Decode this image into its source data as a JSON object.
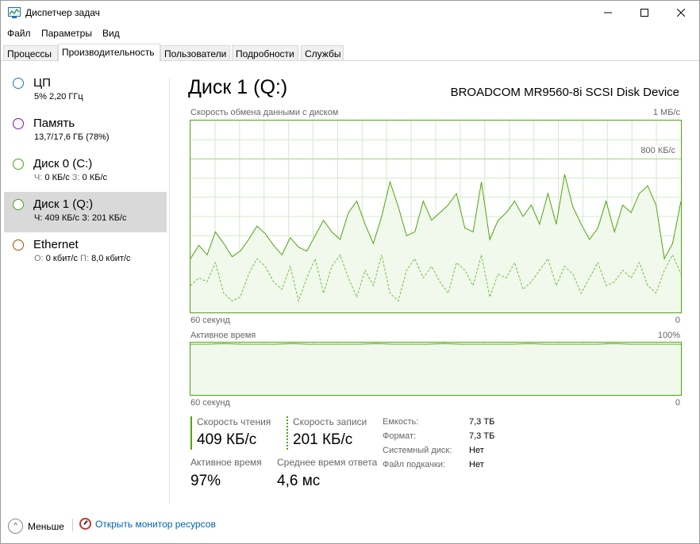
{
  "window": {
    "title": "Диспетчер задач"
  },
  "menu": [
    "Файл",
    "Параметры",
    "Вид"
  ],
  "tabs": [
    {
      "label": "Процессы",
      "active": false
    },
    {
      "label": "Производительность",
      "active": true
    },
    {
      "label": "Пользователи",
      "active": false
    },
    {
      "label": "Подробности",
      "active": false
    },
    {
      "label": "Службы",
      "active": false
    }
  ],
  "sidebar": [
    {
      "name": "ЦП",
      "sub": "5% 2,20 ГГц",
      "color": "#117dbb"
    },
    {
      "name": "Память",
      "sub": "13,7/17,6 ГБ (78%)",
      "color": "#8b12ae"
    },
    {
      "name": "Диск 0 (C:)",
      "sub_k1": "Ч:",
      "sub_v1": "0 КБ/с",
      "sub_k2": "З:",
      "sub_v2": "0 КБ/с",
      "color": "#4da60c"
    },
    {
      "name": "Диск 1 (Q:)",
      "sub_k1": "Ч:",
      "sub_v1": "409 КБ/с",
      "sub_k2": "З:",
      "sub_v2": "201 КБ/с",
      "color": "#4da60c",
      "selected": true
    },
    {
      "name": "Ethernet",
      "sub_k1": "О:",
      "sub_v1": "0 кбит/с",
      "sub_k2": "П:",
      "sub_v2": "8,0 кбит/с",
      "color": "#a74f01"
    }
  ],
  "main": {
    "title": "Диск 1 (Q:)",
    "device": "BROADCOM MR9560-8i SCSI Disk Device",
    "graph1": {
      "label": "Скорость обмена данными с диском",
      "max": "1 МБ/с",
      "marker": "800 КБ/с",
      "xleft": "60 секунд",
      "xright": "0"
    },
    "graph2": {
      "label": "Активное время",
      "max": "100%",
      "xleft": "60 секунд",
      "xright": "0"
    }
  },
  "stats": {
    "read_label": "Скорость чтения",
    "read_value": "409 КБ/с",
    "write_label": "Скорость записи",
    "write_value": "201 КБ/с",
    "active_label": "Активное время",
    "active_value": "97%",
    "resp_label": "Среднее время ответа",
    "resp_value": "4,6 мс"
  },
  "props": [
    {
      "k": "Емкость:",
      "v": "7,3 ТБ"
    },
    {
      "k": "Формат:",
      "v": "7,3 ТБ"
    },
    {
      "k": "Системный диск:",
      "v": "Нет"
    },
    {
      "k": "Файл подкачки:",
      "v": "Нет"
    }
  ],
  "footer": {
    "fewer": "Меньше",
    "resmon": "Открыть монитор ресурсов"
  },
  "chart_data": [
    {
      "type": "line",
      "title": "Скорость обмена данными с диском",
      "ylim_label": "1 МБ/с",
      "series": [
        {
          "name": "Скорость чтения",
          "style": "solid",
          "values": [
            28,
            35,
            30,
            42,
            36,
            29,
            32,
            38,
            45,
            41,
            35,
            30,
            39,
            34,
            32,
            40,
            48,
            42,
            38,
            52,
            58,
            46,
            36,
            50,
            68,
            55,
            40,
            42,
            58,
            48,
            52,
            56,
            62,
            44,
            42,
            68,
            38,
            48,
            52,
            58,
            50,
            56,
            46,
            62,
            46,
            72,
            55,
            46,
            38,
            44,
            58,
            42,
            56,
            52,
            62,
            66,
            56,
            28,
            36,
            58
          ]
        },
        {
          "name": "Скорость записи",
          "style": "dashed",
          "values": [
            14,
            18,
            16,
            26,
            10,
            6,
            8,
            20,
            28,
            24,
            16,
            12,
            24,
            6,
            18,
            28,
            10,
            24,
            30,
            18,
            8,
            22,
            14,
            30,
            10,
            6,
            22,
            28,
            18,
            24,
            16,
            10,
            26,
            22,
            14,
            30,
            8,
            20,
            18,
            26,
            12,
            16,
            22,
            28,
            14,
            24,
            20,
            10,
            18,
            26,
            14,
            16,
            22,
            18,
            26,
            14,
            10,
            22,
            30,
            20
          ]
        }
      ]
    },
    {
      "type": "line",
      "title": "Активное время",
      "ylim_label": "100%",
      "series": [
        {
          "name": "Активное время",
          "values": [
            97,
            97,
            98,
            97,
            97,
            97,
            98,
            97,
            97,
            97,
            97,
            98,
            97,
            97,
            97,
            98,
            97,
            97,
            97,
            97,
            98,
            97,
            97,
            97,
            97,
            98,
            97,
            97,
            97,
            97
          ]
        }
      ]
    }
  ]
}
